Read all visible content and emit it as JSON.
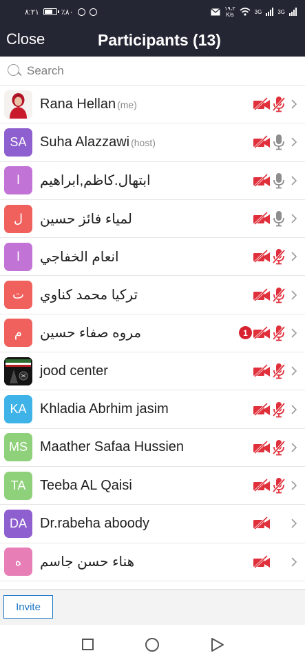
{
  "status_bar": {
    "time": "٨:٢١",
    "battery": "٪٨٠",
    "speed_value": "١٩،٢",
    "speed_unit": "K/s",
    "sim1": "3G",
    "sim2": "3G"
  },
  "header": {
    "close_label": "Close",
    "title": "Participants (13)"
  },
  "search": {
    "placeholder": "Search"
  },
  "participants": [
    {
      "name": "Rana Hellan",
      "tag": "(me)",
      "avatar": "",
      "avatar_color": "#ffffff",
      "video": "off",
      "audio": "muted",
      "rtl": false
    },
    {
      "name": "Suha Alazzawi",
      "tag": "(host)",
      "avatar": "SA",
      "avatar_color": "#8e5fcf",
      "video": "off",
      "audio": "available",
      "rtl": false
    },
    {
      "name": "ابتهال.كاظم,ابراهيم",
      "tag": "",
      "avatar": "ا",
      "avatar_color": "#c274d6",
      "video": "off",
      "audio": "available",
      "rtl": true
    },
    {
      "name": "لمياء فائز حسين",
      "tag": "",
      "avatar": "ل",
      "avatar_color": "#f0615e",
      "video": "off",
      "audio": "available",
      "rtl": true
    },
    {
      "name": "انعام الخفاجي",
      "tag": "",
      "avatar": "ا",
      "avatar_color": "#c274d6",
      "video": "off",
      "audio": "muted",
      "rtl": true
    },
    {
      "name": "تركيا محمد كناوي",
      "tag": "",
      "avatar": "ت",
      "avatar_color": "#f0615e",
      "video": "off",
      "audio": "muted",
      "rtl": true
    },
    {
      "name": "مروه صفاء حسين",
      "tag": "",
      "avatar": "م",
      "avatar_color": "#f0615e",
      "video": "off",
      "audio": "muted",
      "rtl": true,
      "badge": "1"
    },
    {
      "name": "jood center",
      "tag": "",
      "avatar": "",
      "avatar_color": "#111111",
      "video": "off",
      "audio": "muted",
      "rtl": false
    },
    {
      "name": "Khladia Abrhim jasim",
      "tag": "",
      "avatar": "KA",
      "avatar_color": "#3fb3e8",
      "video": "off",
      "audio": "muted",
      "rtl": false
    },
    {
      "name": "Maather Safaa Hussien",
      "tag": "",
      "avatar": "MS",
      "avatar_color": "#8fd17a",
      "video": "off",
      "audio": "muted",
      "rtl": false
    },
    {
      "name": "Teeba AL Qaisi",
      "tag": "",
      "avatar": "TA",
      "avatar_color": "#8fd17a",
      "video": "off",
      "audio": "muted",
      "rtl": false
    },
    {
      "name": "Dr.rabeha aboody",
      "tag": "",
      "avatar": "DA",
      "avatar_color": "#8e5fcf",
      "video": "off",
      "audio": "none",
      "rtl": false
    },
    {
      "name": "هناء حسن جاسم",
      "tag": "",
      "avatar": "ه",
      "avatar_color": "#e77fb6",
      "video": "off",
      "audio": "none",
      "rtl": true
    }
  ],
  "footer": {
    "invite_label": "Invite"
  },
  "colors": {
    "header_bg": "#252634",
    "muted_red": "#e0303b",
    "mic_gray": "#8e8e8e",
    "invite_blue": "#1b75c5"
  }
}
